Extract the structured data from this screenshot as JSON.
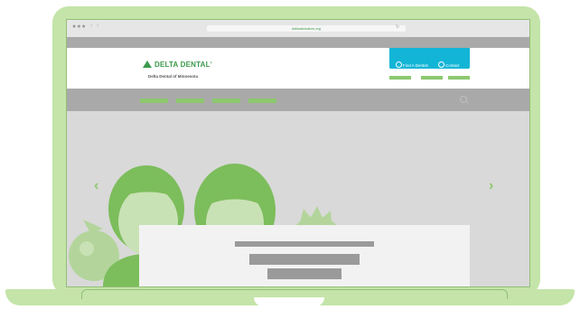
{
  "browser": {
    "url": "deltadentalmn.org",
    "dots": "●●●",
    "back_glyph": "‹",
    "forward_glyph": "›",
    "reload_glyph": "↻"
  },
  "site": {
    "logo_text": "DELTA DENTAL",
    "logo_mark": "®",
    "tagline": "Delta Dental of Minnesota",
    "cta": {
      "find_label": "Find A Dentist",
      "contact_label": "Contact",
      "color": "#13b5d6"
    }
  },
  "hero": {
    "prev_glyph": "‹",
    "next_glyph": "›",
    "illustration": "family-silhouettes"
  },
  "colors": {
    "brand_green": "#3d9a4c",
    "accent_green": "#8dc86f",
    "laptop_green": "#c4e4a9",
    "nav_gray": "#a9a9a9"
  },
  "icons": {
    "find": "tooth-icon",
    "contact": "person-icon",
    "search": "search-icon"
  }
}
